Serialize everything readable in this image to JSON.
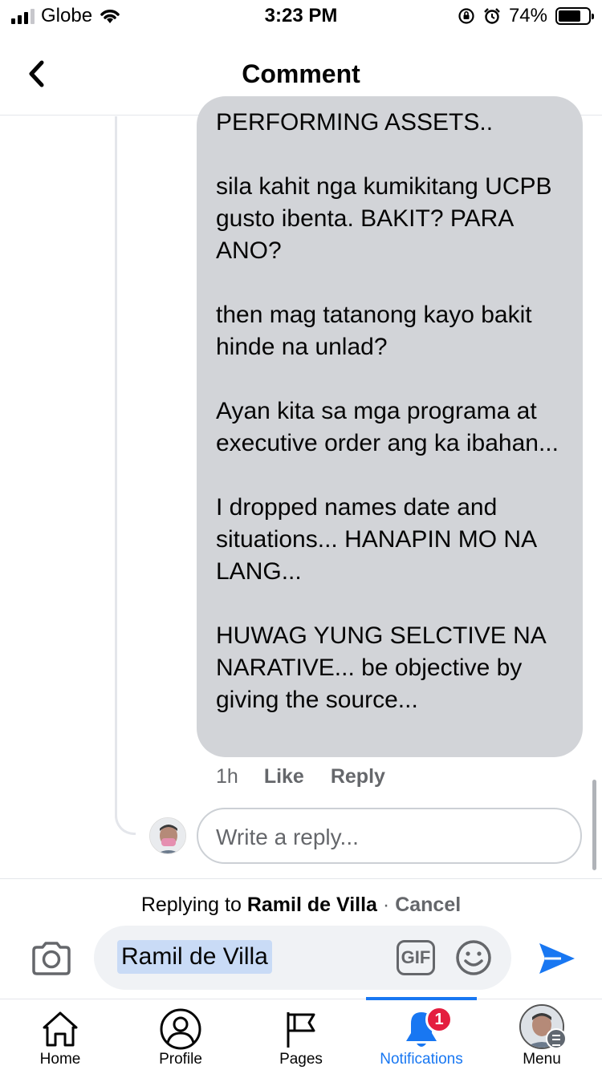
{
  "status_bar": {
    "carrier": "Globe",
    "time": "3:23 PM",
    "battery_percent": "74%",
    "battery_level": 0.74
  },
  "header": {
    "title": "Comment",
    "back_icon": "chevron-left-icon"
  },
  "comment": {
    "text": "PERFORMING ASSETS..\n\nsila kahit nga kumikitang UCPB gusto ibenta. BAKIT? PARA ANO?\n\nthen mag tatanong kayo bakit hinde na unlad?\n\nAyan kita sa mga programa at executive order ang ka ibahan...\n\nI dropped names date and situations... HANAPIN MO NA LANG...\n\nHUWAG YUNG SELCTIVE NA NARATIVE... be objective by giving the source...",
    "time": "1h",
    "like_label": "Like",
    "reply_label": "Reply"
  },
  "reply_box": {
    "placeholder": "Write a reply..."
  },
  "composer": {
    "replying_prefix": "Replying to",
    "replying_name": "Ramil de Villa",
    "separator": "·",
    "cancel_label": "Cancel",
    "mention": "Ramil de Villa",
    "gif_label": "GIF"
  },
  "tabbar": {
    "accent_color": "#1877f2",
    "tabs": [
      {
        "label": "Home",
        "icon": "home-icon"
      },
      {
        "label": "Profile",
        "icon": "profile-icon"
      },
      {
        "label": "Pages",
        "icon": "flag-icon"
      },
      {
        "label": "Notifications",
        "icon": "bell-icon",
        "active": true,
        "badge": "1"
      },
      {
        "label": "Menu",
        "icon": "menu-avatar-icon"
      }
    ]
  }
}
